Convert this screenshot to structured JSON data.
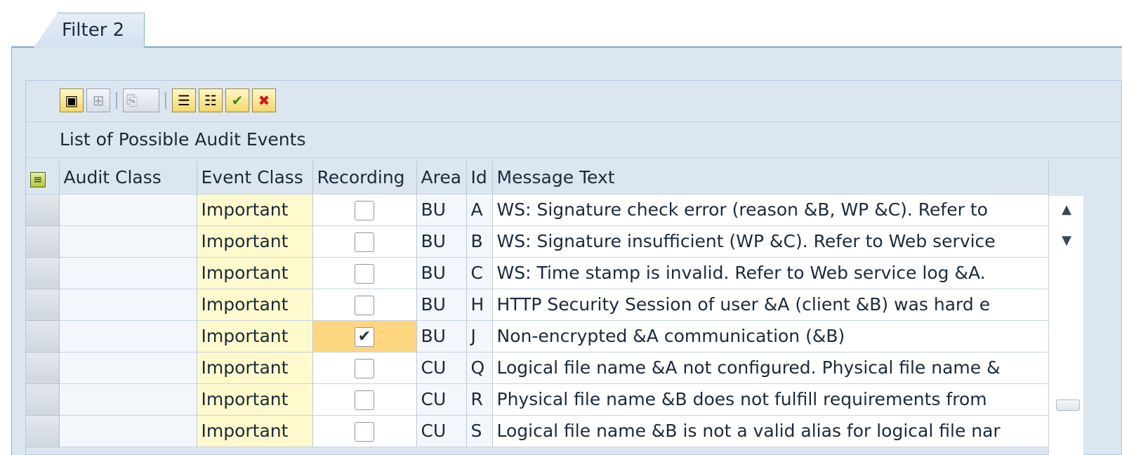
{
  "tab": {
    "label": "Filter 2"
  },
  "toolbar": {
    "buttons": [
      {
        "name": "details-icon",
        "glyph": "▣"
      },
      {
        "name": "insert-row-icon",
        "glyph": "⊞"
      },
      {
        "name": "print-preview-icon",
        "glyph": "⎘"
      },
      {
        "name": "select-all-icon",
        "glyph": "☰"
      },
      {
        "name": "deselect-all-icon",
        "glyph": "☷"
      },
      {
        "name": "accept-icon",
        "glyph": "✔"
      },
      {
        "name": "cancel-icon",
        "glyph": "✖"
      }
    ]
  },
  "list": {
    "title": "List of Possible Audit Events",
    "columns": [
      "Audit Class",
      "Event Class",
      "Recording",
      "Area",
      "Id",
      "Message Text"
    ],
    "rows": [
      {
        "audit_class": "",
        "event_class": "Important",
        "recording": "",
        "area": "BU",
        "id": "A",
        "message": "WS: Signature check error (reason &B, WP &C). Refer to"
      },
      {
        "audit_class": "",
        "event_class": "Important",
        "recording": "",
        "area": "BU",
        "id": "B",
        "message": "WS: Signature insufficient (WP &C). Refer to Web service"
      },
      {
        "audit_class": "",
        "event_class": "Important",
        "recording": "",
        "area": "BU",
        "id": "C",
        "message": "WS: Time stamp is invalid. Refer to Web service log &A."
      },
      {
        "audit_class": "",
        "event_class": "Important",
        "recording": "",
        "area": "BU",
        "id": "H",
        "message": "HTTP Security Session of user &A (client &B) was hard e"
      },
      {
        "audit_class": "",
        "event_class": "Important",
        "recording": "✔",
        "area": "BU",
        "id": "J",
        "message": "Non-encrypted &A communication (&B)"
      },
      {
        "audit_class": "",
        "event_class": "Important",
        "recording": "",
        "area": "CU",
        "id": "Q",
        "message": "Logical file name &A not configured. Physical file name &"
      },
      {
        "audit_class": "",
        "event_class": "Important",
        "recording": "",
        "area": "CU",
        "id": "R",
        "message": "Physical file name &B does not fulfill requirements from"
      },
      {
        "audit_class": "",
        "event_class": "Important",
        "recording": "",
        "area": "CU",
        "id": "S",
        "message": "Logical file name &B is not a valid alias for logical file nar"
      }
    ]
  },
  "scrollbar": {
    "up": "▲",
    "down": "▼"
  }
}
